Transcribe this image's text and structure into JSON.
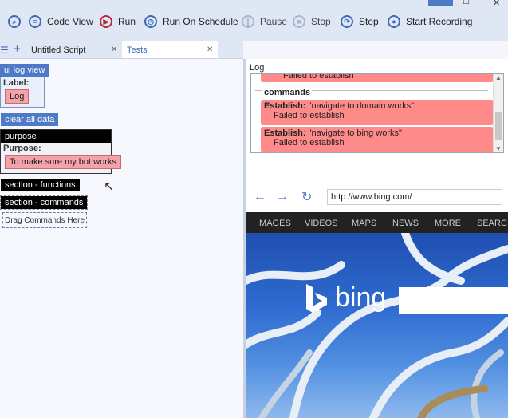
{
  "toolbar": {
    "code_view": "Code View",
    "run": "Run",
    "run_on_schedule": "Run On Schedule",
    "pause": "Pause",
    "stop": "Stop",
    "step": "Step",
    "start_recording": "Start Recording"
  },
  "tabs": {
    "tab1": "Untitled Script",
    "tab2": "Tests",
    "close": "✕"
  },
  "left": {
    "ui_log_view": "ui log view",
    "label_caption": "Label:",
    "label_value": "Log",
    "clear_all_data": "clear all data",
    "purpose_header": "purpose",
    "purpose_caption": "Purpose:",
    "purpose_value": "To make sure my bot works",
    "section_functions": "section - functions",
    "section_commands": "section - commands",
    "drag_commands": "Drag Commands Here"
  },
  "log": {
    "title": "Log",
    "top_partial": "Failed to establish",
    "group": "commands",
    "entries": [
      {
        "key": "Establish:",
        "value": "\"navigate to domain works\"",
        "status": "Failed to establish"
      },
      {
        "key": "Establish:",
        "value": "\"navigate to bing works\"",
        "status": "Failed to establish"
      }
    ]
  },
  "browser": {
    "url": "http://www.bing.com/",
    "nav": [
      "IMAGES",
      "VIDEOS",
      "MAPS",
      "NEWS",
      "MORE",
      "SEARC"
    ],
    "logo": "bing"
  },
  "colors": {
    "accent": "#4d79c7",
    "error": "#ff8a8a",
    "pink": "#f4a3a8"
  }
}
